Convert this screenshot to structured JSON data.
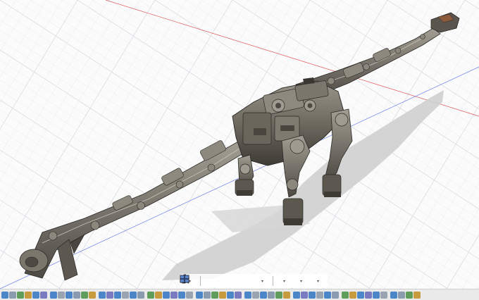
{
  "app": {
    "name": "3D CAD viewport",
    "view": "perspective"
  },
  "model": {
    "material_color": "#6e6a60",
    "highlight_color": "#8a857a",
    "shadow_color": "#c9c9c9"
  },
  "grid": {
    "visible": true,
    "minor_color": "#e6e9ee",
    "major_color": "#d4d8df",
    "x_axis_color": "#e05555",
    "y_axis_color": "#6a7ee8"
  },
  "navigation_toolbar": {
    "items": [
      {
        "name": "orbit-icon",
        "dropdown": true
      },
      {
        "name": "look-at-icon",
        "dropdown": false
      },
      {
        "name": "pan-icon",
        "dropdown": false
      },
      {
        "name": "zoom-icon",
        "dropdown": false
      },
      {
        "name": "zoom-window-icon",
        "dropdown": true
      },
      {
        "name": "display-settings-icon",
        "dropdown": true
      },
      {
        "name": "grid-settings-icon",
        "dropdown": true
      },
      {
        "name": "viewports-icon",
        "dropdown": true
      }
    ]
  },
  "timeline": {
    "item_count": 52,
    "colors": [
      "#4a86c8",
      "#8a9bb0",
      "#5f9e5a",
      "#c89a3e",
      "#4a86c8",
      "#7a7ac0",
      "#4a86c8",
      "#9aa4b0"
    ]
  }
}
